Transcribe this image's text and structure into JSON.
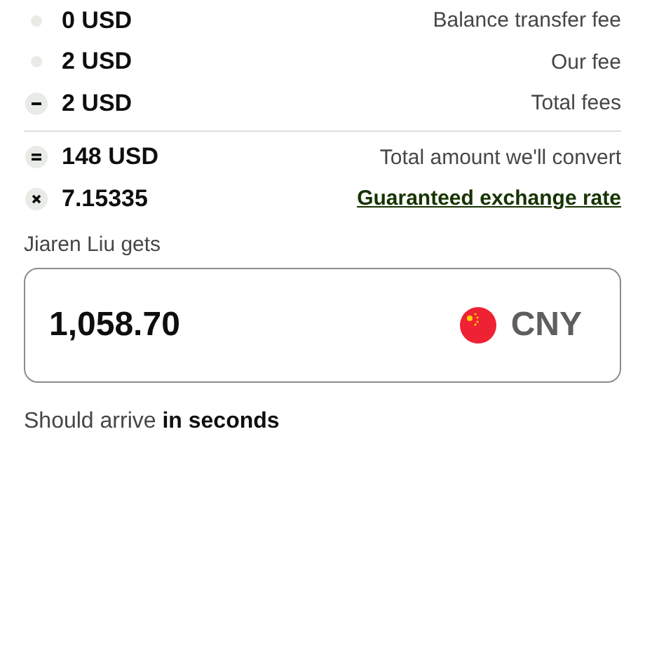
{
  "fees": [
    {
      "kind": "dot",
      "amount": "0 USD",
      "label": "Balance transfer fee",
      "link": false
    },
    {
      "kind": "dot",
      "amount": "2 USD",
      "label": "Our fee",
      "link": false
    },
    {
      "kind": "minus",
      "amount": "2 USD",
      "label": "Total fees",
      "link": false
    }
  ],
  "conversion": [
    {
      "kind": "equals",
      "amount": "148 USD",
      "label": "Total amount we'll convert",
      "link": false
    },
    {
      "kind": "times",
      "amount": "7.15335",
      "label": "Guaranteed exchange rate",
      "link": true
    }
  ],
  "recipient": {
    "label": "Jiaren Liu gets",
    "amount": "1,058.70",
    "currency": "CNY"
  },
  "arrival": "Should arrive **in seconds**"
}
